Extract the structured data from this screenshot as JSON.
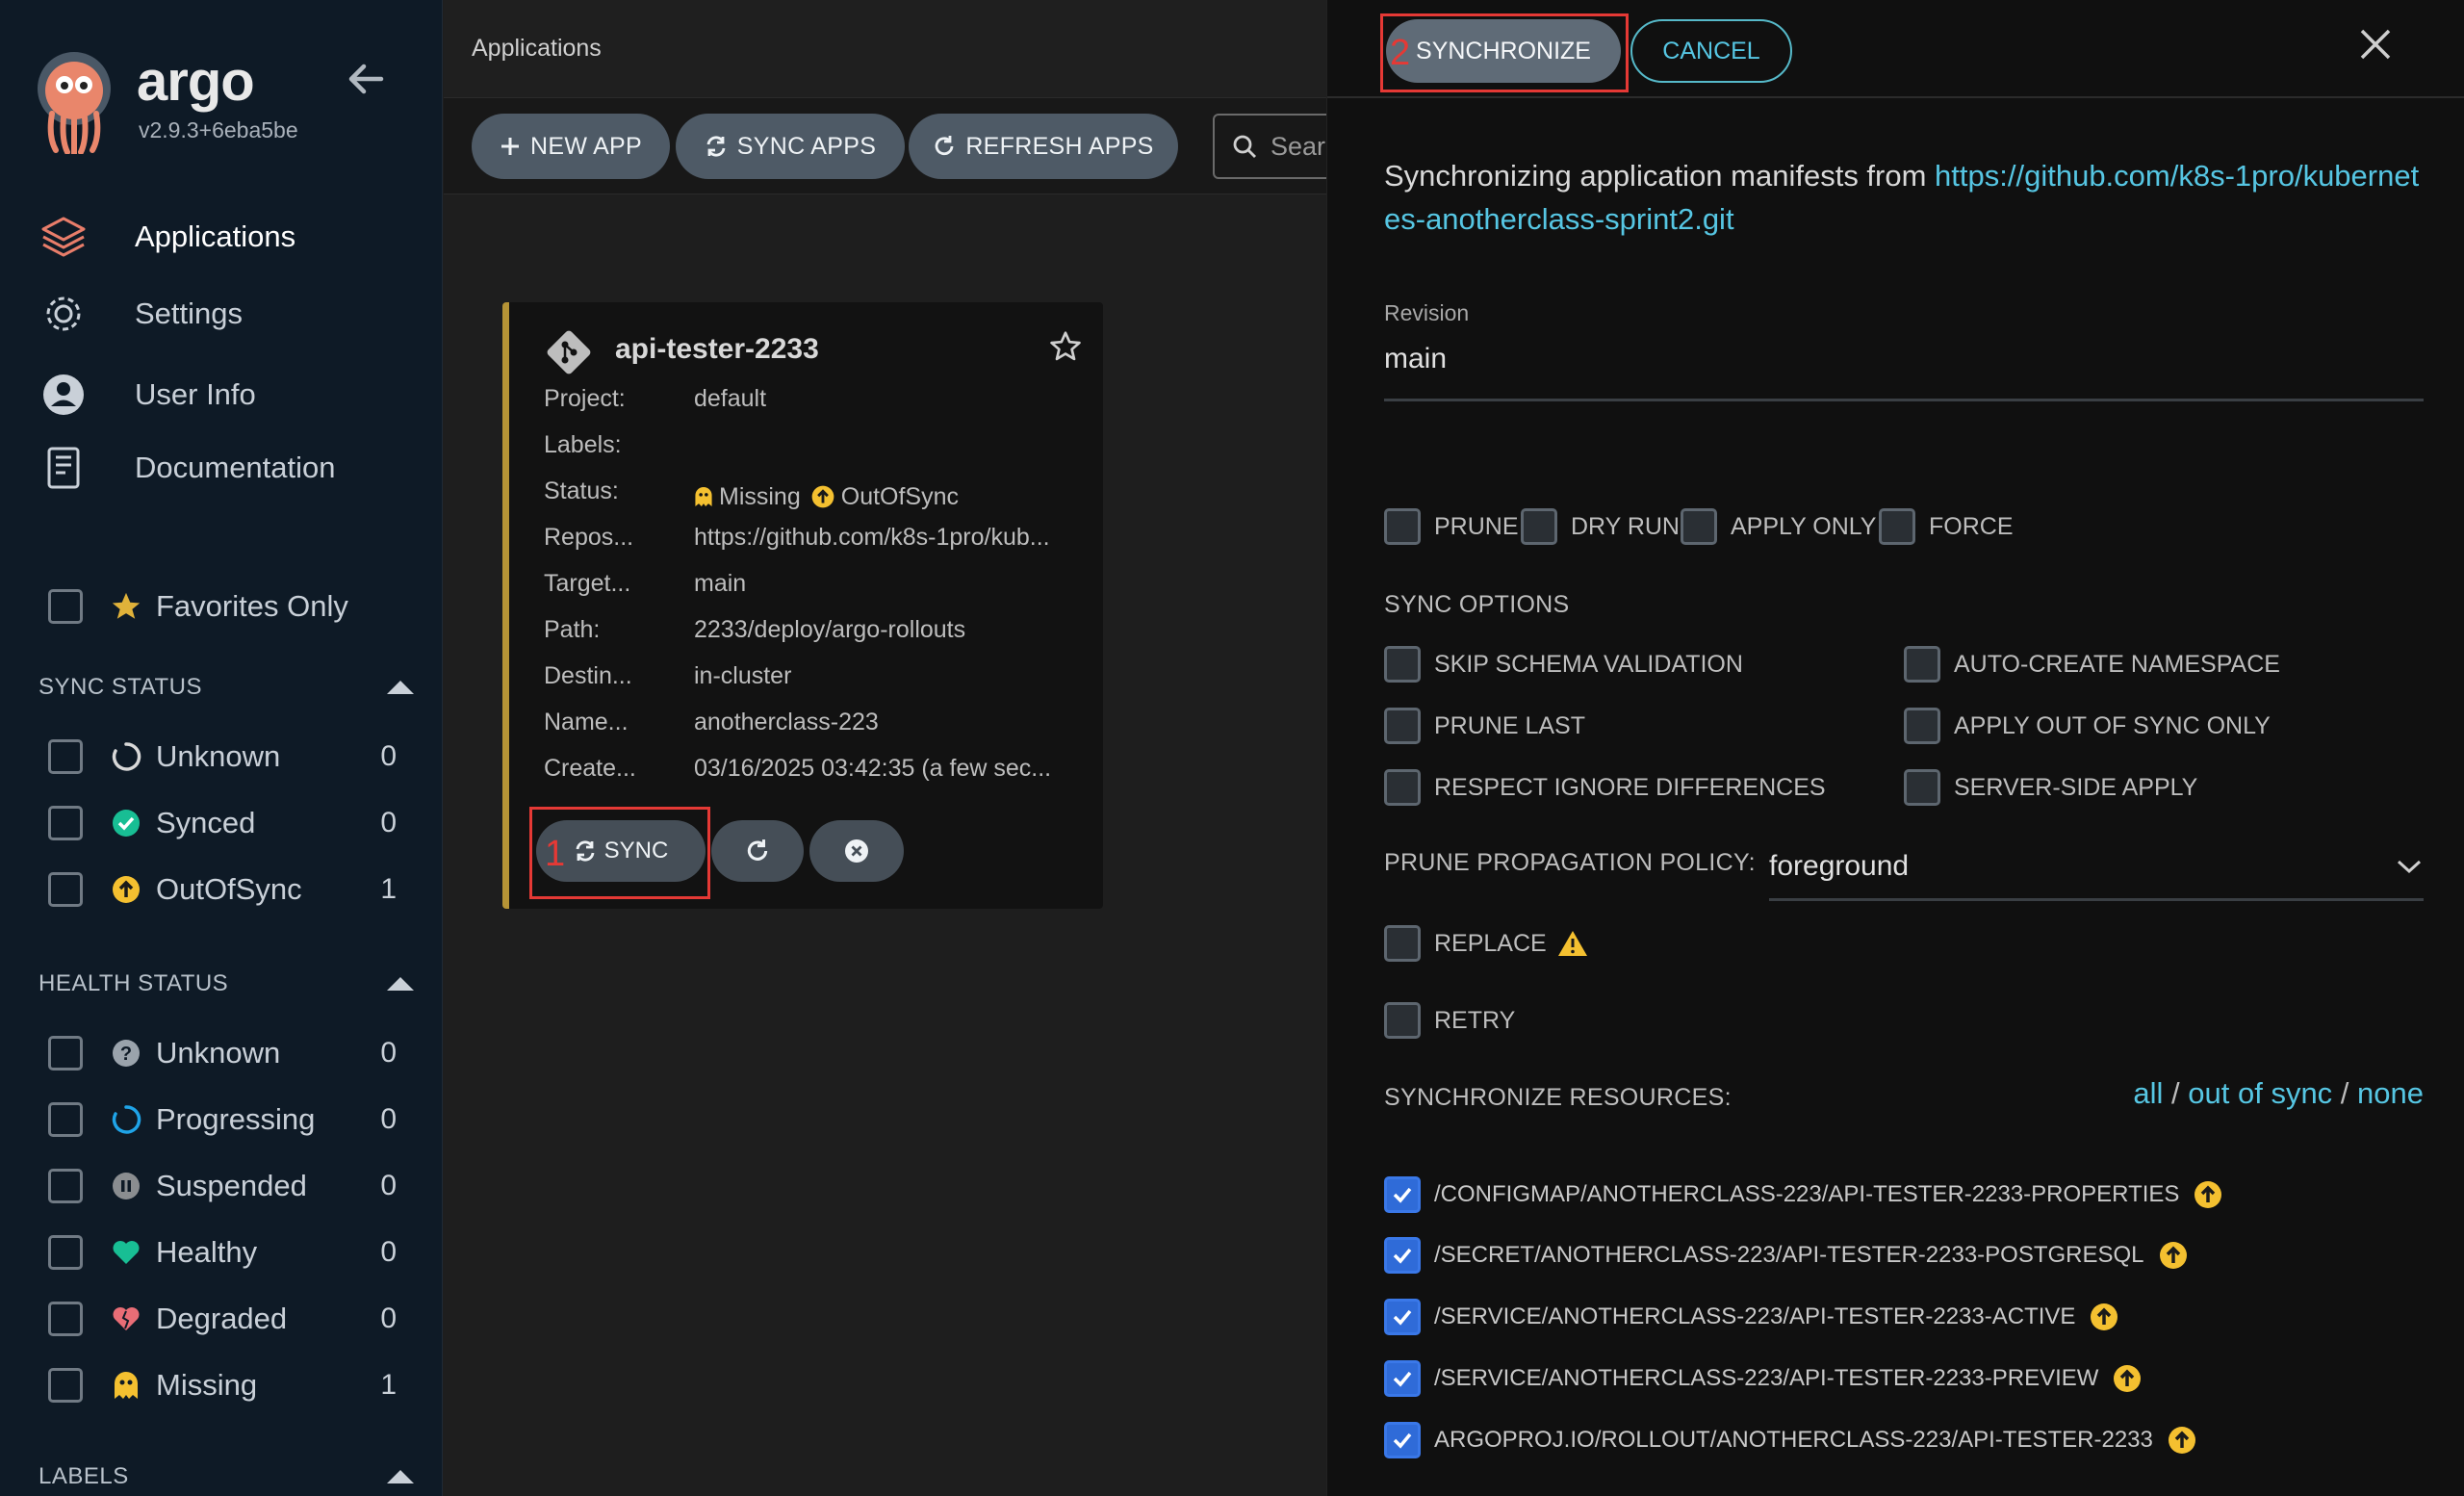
{
  "sidebar": {
    "brand": "argo",
    "version": "v2.9.3+6eba5be",
    "nav": [
      {
        "label": "Applications",
        "icon": "layers-icon"
      },
      {
        "label": "Settings",
        "icon": "gear-icon"
      },
      {
        "label": "User Info",
        "icon": "user-icon"
      },
      {
        "label": "Documentation",
        "icon": "book-icon"
      }
    ],
    "favorites_label": "Favorites Only",
    "sync_status": {
      "title": "SYNC STATUS",
      "items": [
        {
          "label": "Unknown",
          "count": "0"
        },
        {
          "label": "Synced",
          "count": "0"
        },
        {
          "label": "OutOfSync",
          "count": "1"
        }
      ]
    },
    "health_status": {
      "title": "HEALTH STATUS",
      "items": [
        {
          "label": "Unknown",
          "count": "0"
        },
        {
          "label": "Progressing",
          "count": "0"
        },
        {
          "label": "Suspended",
          "count": "0"
        },
        {
          "label": "Healthy",
          "count": "0"
        },
        {
          "label": "Degraded",
          "count": "0"
        },
        {
          "label": "Missing",
          "count": "1"
        }
      ]
    },
    "labels_title": "LABELS"
  },
  "header": {
    "title": "Applications"
  },
  "toolbar": {
    "new_app": "NEW APP",
    "sync_apps": "SYNC APPS",
    "refresh_apps": "REFRESH APPS",
    "search_placeholder": "Sear"
  },
  "app_card": {
    "name": "api-tester-2233",
    "fields": [
      {
        "key": "Project:",
        "value": "default"
      },
      {
        "key": "Labels:",
        "value": ""
      },
      {
        "key": "Status:",
        "value": ""
      },
      {
        "key": "Repos...",
        "value": "https://github.com/k8s-1pro/kub..."
      },
      {
        "key": "Target...",
        "value": "main"
      },
      {
        "key": "Path:",
        "value": "2233/deploy/argo-rollouts"
      },
      {
        "key": "Destin...",
        "value": "in-cluster"
      },
      {
        "key": "Name...",
        "value": "anotherclass-223"
      },
      {
        "key": "Create...",
        "value": "03/16/2025 03:42:35  (a few sec..."
      }
    ],
    "status_health": "Missing",
    "status_sync": "OutOfSync",
    "sync_button": "SYNC",
    "annotation_1": "1"
  },
  "panel": {
    "synchronize": "SYNCHRONIZE",
    "cancel": "CANCEL",
    "annotation_2": "2",
    "message_prefix": "Synchronizing application manifests from ",
    "repo_url": "https://github.com/k8s-1pro/kubernetes-anotherclass-sprint2.git",
    "revision_label": "Revision",
    "revision_value": "main",
    "options": [
      "PRUNE",
      "DRY RUN",
      "APPLY ONLY",
      "FORCE"
    ],
    "sync_options_title": "SYNC OPTIONS",
    "sync_options_left": [
      "SKIP SCHEMA VALIDATION",
      "PRUNE LAST",
      "RESPECT IGNORE DIFFERENCES"
    ],
    "sync_options_right": [
      "AUTO-CREATE NAMESPACE",
      "APPLY OUT OF SYNC ONLY",
      "SERVER-SIDE APPLY"
    ],
    "prune_policy_label": "PRUNE PROPAGATION POLICY:",
    "prune_policy_value": "foreground",
    "replace_label": "REPLACE",
    "retry_label": "RETRY",
    "resources_label": "SYNCHRONIZE RESOURCES:",
    "select_all": "all",
    "select_out_of_sync": "out of sync",
    "select_none": "none",
    "resources": [
      "/CONFIGMAP/ANOTHERCLASS-223/API-TESTER-2233-PROPERTIES",
      "/SECRET/ANOTHERCLASS-223/API-TESTER-2233-POSTGRESQL",
      "/SERVICE/ANOTHERCLASS-223/API-TESTER-2233-ACTIVE",
      "/SERVICE/ANOTHERCLASS-223/API-TESTER-2233-PREVIEW",
      "ARGOPROJ.IO/ROLLOUT/ANOTHERCLASS-223/API-TESTER-2233"
    ]
  },
  "colors": {
    "accent_link": "#56c6e3",
    "out_of_sync": "#f4c030",
    "synced": "#18be94",
    "healthy": "#18be94",
    "degraded": "#e96d76",
    "annotation": "#e53935"
  }
}
